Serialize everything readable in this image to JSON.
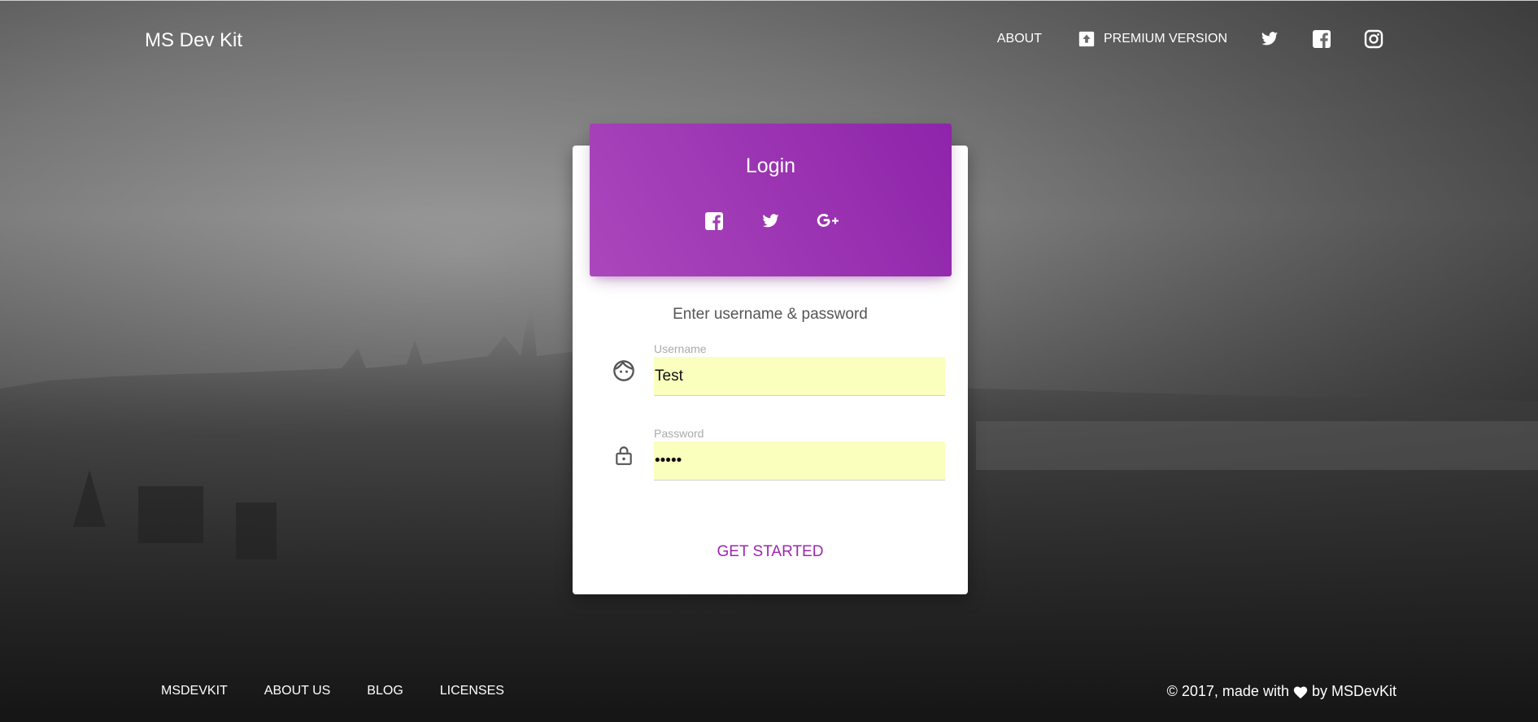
{
  "navbar": {
    "brand": "MS Dev Kit",
    "links": {
      "about": "ABOUT",
      "premium": "PREMIUM VERSION"
    },
    "icons": [
      "twitter-icon",
      "facebook-icon",
      "instagram-icon"
    ]
  },
  "login": {
    "title": "Login",
    "social_icons": [
      "facebook-icon",
      "twitter-icon",
      "google-plus-icon"
    ],
    "description": "Enter username & password",
    "username": {
      "label": "Username",
      "value": "Test"
    },
    "password": {
      "label": "Password",
      "value": "•••••"
    },
    "submit_label": "GET STARTED"
  },
  "footer": {
    "links": [
      "MSDEVKIT",
      "ABOUT US",
      "BLOG",
      "LICENSES"
    ],
    "copyright_prefix": "© 2017, made with",
    "copyright_suffix": "by MSDevKit"
  },
  "colors": {
    "accent": "#9c27b0",
    "header_gradient_start": "#ab47bc",
    "header_gradient_end": "#8e24aa",
    "autofill": "#faffbd"
  }
}
